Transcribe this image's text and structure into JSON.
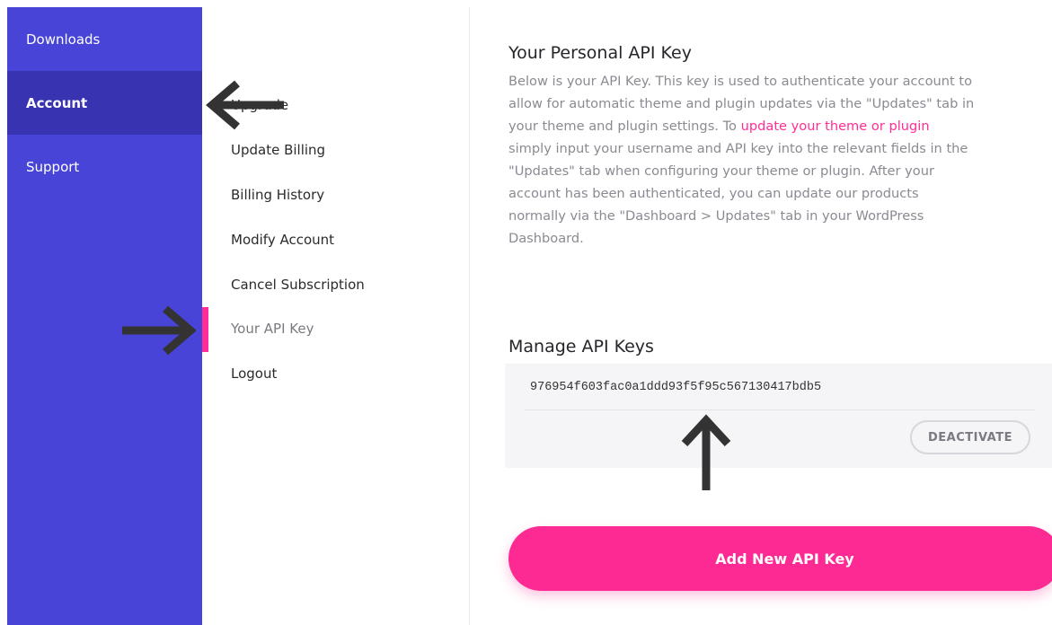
{
  "sidebar": {
    "items": [
      {
        "label": "Downloads"
      },
      {
        "label": "Account"
      },
      {
        "label": "Support"
      }
    ]
  },
  "submenu": {
    "items": [
      {
        "label": "Upgrade"
      },
      {
        "label": "Update Billing"
      },
      {
        "label": "Billing History"
      },
      {
        "label": "Modify Account"
      },
      {
        "label": "Cancel Subscription"
      },
      {
        "label": "Your API Key"
      },
      {
        "label": "Logout"
      }
    ]
  },
  "content": {
    "title": "Your Personal API Key",
    "desc_lines": [
      "Below is your API Key. This key is used to authenticate your account to",
      "allow for automatic theme and plugin updates via the \"Updates\" tab in",
      "your theme and plugin settings. To ",
      "simply input your username and API key into the relevant fields in the",
      "\"Updates\" tab when configuring your theme or plugin. After your",
      "account has been authenticated, you can update our products",
      "normally via the \"Dashboard > Updates\" tab in your WordPress",
      "Dashboard."
    ],
    "link_text": "update your theme or plugin",
    "manage_title": "Manage API Keys",
    "api_key": "976954f603fac0a1ddd93f5f95c567130417bdb5",
    "deactivate_label": "DEACTIVATE",
    "add_label": "Add New API Key"
  },
  "colors": {
    "sidebar": "#4844d8",
    "sidebar_active": "#3833b1",
    "accent": "#ff2d95"
  }
}
